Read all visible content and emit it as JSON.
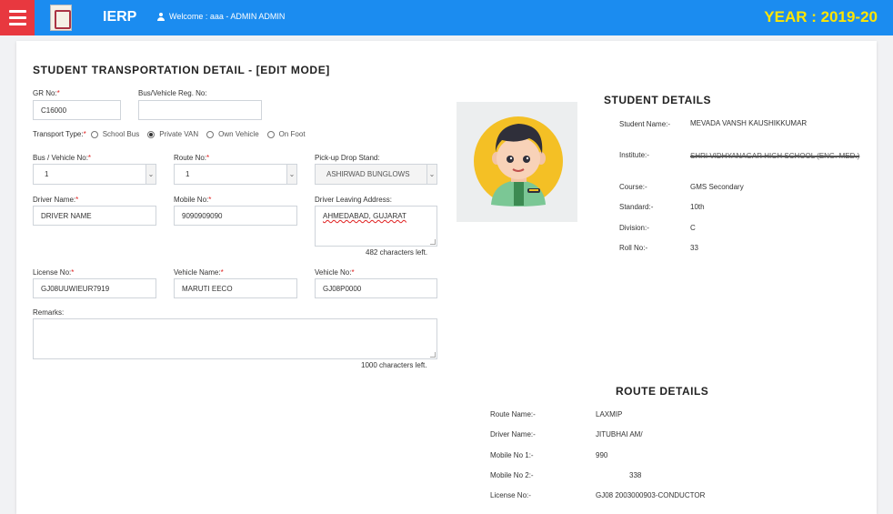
{
  "header": {
    "app_name": "IERP",
    "welcome": "Welcome : aaa - ADMIN ADMIN",
    "year": "YEAR : 2019-20"
  },
  "form": {
    "title": "STUDENT TRANSPORTATION DETAIL - [EDIT MODE]",
    "gr_no": {
      "label": "GR No:",
      "value": "C16000"
    },
    "bus_reg": {
      "label": "Bus/Vehicle Reg. No:",
      "value": ""
    },
    "transport_type": {
      "label": "Transport Type:",
      "options": [
        "School Bus",
        "Private VAN",
        "Own Vehicle",
        "On Foot"
      ],
      "selected": "Private VAN"
    },
    "bus_vehicle_no": {
      "label": "Bus / Vehicle No:",
      "value": "1"
    },
    "route_no": {
      "label": "Route No:",
      "value": "1"
    },
    "pickup_drop": {
      "label": "Pick-up Drop Stand:",
      "value": "ASHIRWAD BUNGLOWS"
    },
    "driver_name": {
      "label": "Driver Name:",
      "value": "DRIVER NAME"
    },
    "mobile_no": {
      "label": "Mobile No:",
      "value": "9090909090"
    },
    "driver_address": {
      "label": "Driver Leaving Address:",
      "value": "AHMEDABAD, GUJARAT",
      "counter": "482 characters left."
    },
    "license_no": {
      "label": "License No:",
      "value": "GJ08UUWIEUR7919"
    },
    "vehicle_name": {
      "label": "Vehicle Name:",
      "value": "MARUTI EECO"
    },
    "vehicle_no": {
      "label": "Vehicle No:",
      "value": "GJ08P0000"
    },
    "remarks": {
      "label": "Remarks:",
      "value": "",
      "counter": "1000 characters left."
    },
    "required_mark": "*"
  },
  "student": {
    "title": "STUDENT DETAILS",
    "name_label": "Student Name:-",
    "name": "MEVADA VANSH KAUSHIKKUMAR",
    "institute_label": "Institute:-",
    "institute": "SHRI VIDHYANAGAR HIGH SCHOOL (ENG. MED.)",
    "course_label": "Course:-",
    "course": "GMS Secondary",
    "standard_label": "Standard:-",
    "standard": "10th",
    "division_label": "Division:-",
    "division": "C",
    "roll_label": "Roll No:-",
    "roll": "33"
  },
  "route": {
    "title": "ROUTE DETAILS",
    "route_name_label": "Route Name:-",
    "route_name": "LAXMIP",
    "driver_name_label": "Driver Name:-",
    "driver_name": "JITUBHAI AM/",
    "mobile1_label": "Mobile No 1:-",
    "mobile1": "990",
    "mobile2_label": "Mobile No 2:-",
    "mobile2": "338",
    "license_label": "License No:-",
    "license": "GJ08 2003000903-CONDUCTOR"
  }
}
